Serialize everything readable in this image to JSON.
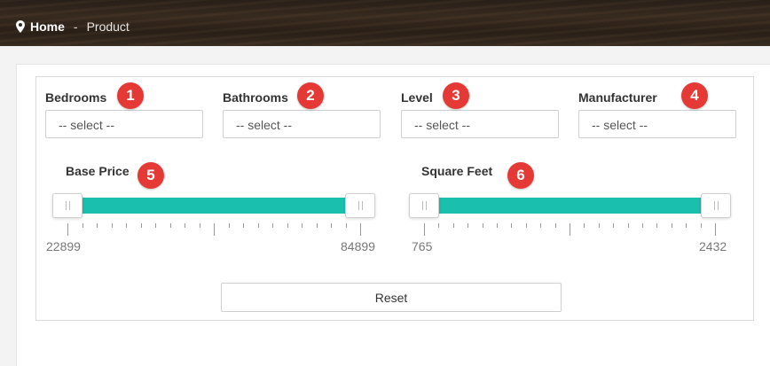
{
  "breadcrumb": {
    "home": "Home",
    "separator": "-",
    "current": "Product"
  },
  "filters": [
    {
      "label": "Bedrooms",
      "select": "-- select --",
      "badge": "1"
    },
    {
      "label": "Bathrooms",
      "select": "-- select --",
      "badge": "2"
    },
    {
      "label": "Level",
      "select": "-- select --",
      "badge": "3"
    },
    {
      "label": "Manufacturer",
      "select": "-- select --",
      "badge": "4"
    }
  ],
  "sliders": [
    {
      "label": "Base Price",
      "badge": "5",
      "min": "22899",
      "max": "84899"
    },
    {
      "label": "Square Feet",
      "badge": "6",
      "min": "765",
      "max": "2432"
    }
  ],
  "reset_label": "Reset",
  "colors": {
    "track": "#1bbfad",
    "badge": "#e53935"
  }
}
